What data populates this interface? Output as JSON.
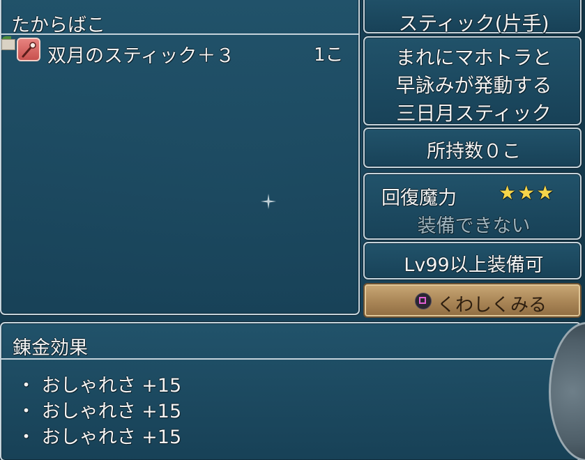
{
  "box_panel": {
    "title": "たからばこ",
    "item": {
      "name": "双月のスティック＋３",
      "count": "1こ",
      "icon": "wand-icon"
    }
  },
  "item_info": {
    "type": "スティック(片手)",
    "description": [
      "まれにマホトラと",
      "早詠みが発動する",
      "三日月スティック"
    ],
    "owned": "所持数０こ",
    "stat": {
      "name": "回復魔力",
      "stars": "★★★",
      "equip_status": "装備できない"
    },
    "level_requirement": "Lv99以上装備可",
    "detail_button": "くわしくみる"
  },
  "alchemy": {
    "title": "錬金効果",
    "effects": [
      "・ おしゃれさ +15",
      "・ おしゃれさ +15",
      "・ おしゃれさ +15"
    ]
  },
  "colors": {
    "panel_border": "#c6d4dc",
    "star": "#f6d54a",
    "disabled_text": "#9fb4be",
    "button_bg": "#a98556"
  }
}
